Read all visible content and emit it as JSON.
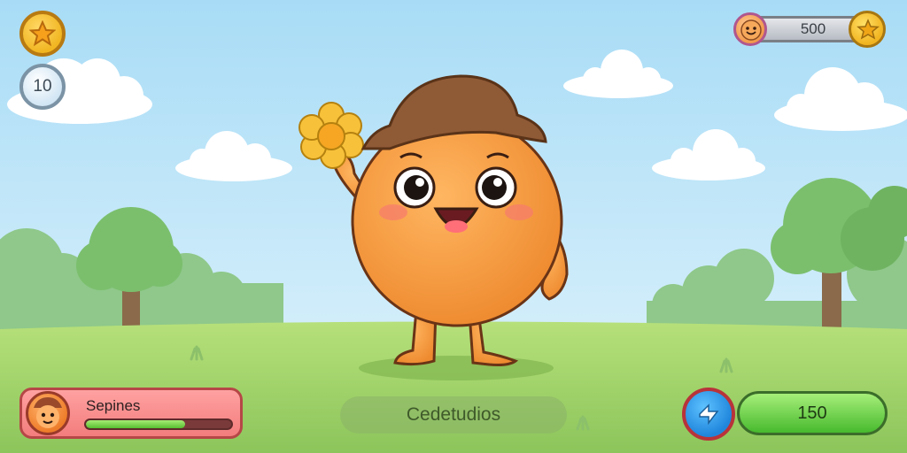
{
  "hud": {
    "level_value": "10",
    "coins_value": "500",
    "star_icon": "star-icon",
    "coin_icon": "coin-icon"
  },
  "player": {
    "name": "Sepines",
    "health_fraction": 0.68
  },
  "banner": {
    "text": "Cedetudios"
  },
  "action": {
    "value": "150",
    "boost_icon": "lightning-icon"
  },
  "colors": {
    "sky_top": "#bfe6f9",
    "grass": "#a3d36a",
    "character": "#f39a3e",
    "hat": "#8a5a3a"
  }
}
